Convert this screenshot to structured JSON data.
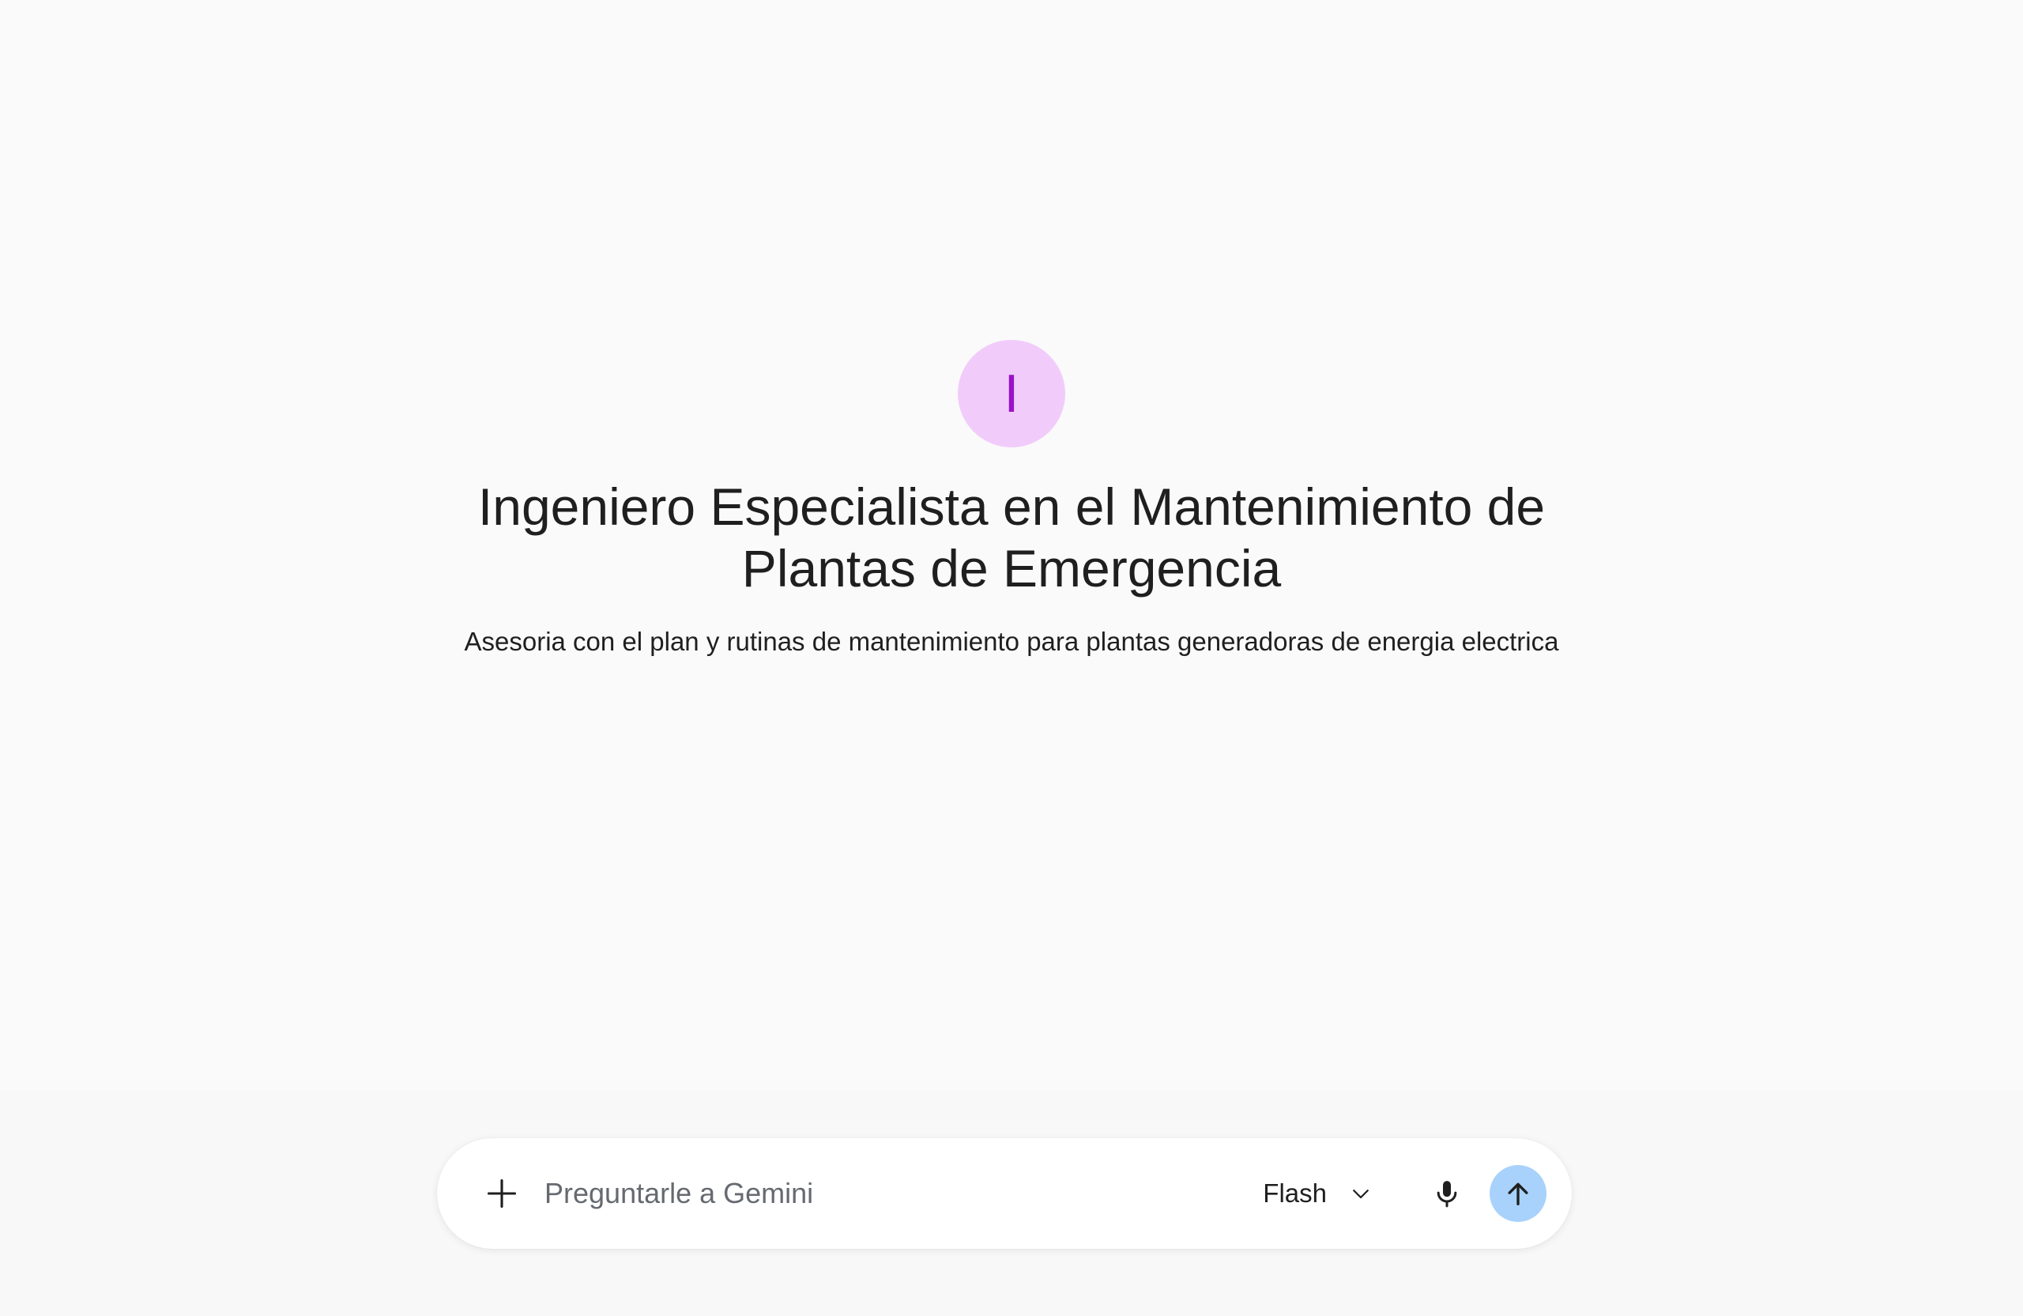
{
  "gem": {
    "avatar_letter": "I",
    "avatar_bg": "#f1ccfb",
    "avatar_fg": "#9a11c8",
    "title": "Ingeniero Especialista en el Mantenimiento de Plantas de Emergencia",
    "description": "Asesoria con el plan y rutinas de mantenimiento para plantas generadoras de energia electrica"
  },
  "composer": {
    "placeholder": "Preguntarle a Gemini",
    "value": "",
    "add_icon": "plus-icon",
    "model_label": "Flash",
    "model_icon": "chevron-down-icon",
    "mic_icon": "microphone-icon",
    "send_icon": "arrow-up-icon",
    "send_color": "#a8d2fb"
  }
}
